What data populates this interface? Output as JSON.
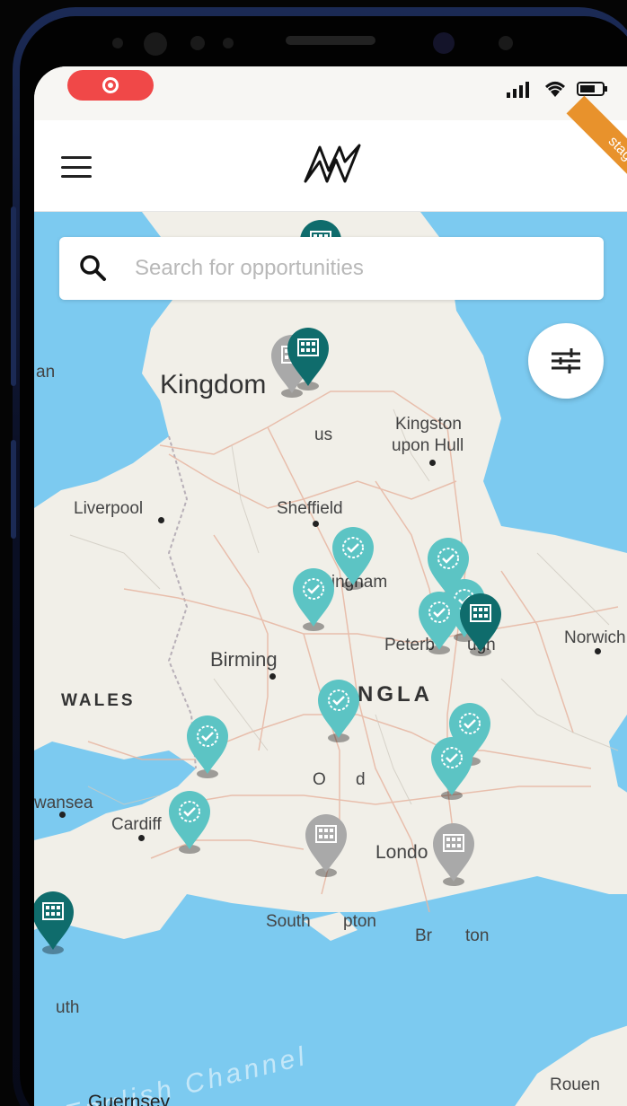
{
  "status_bar": {
    "record_indicator": "record-icon",
    "icons": [
      "signal-icon",
      "wifi-icon",
      "battery-icon"
    ]
  },
  "header": {
    "menu_icon": "hamburger-menu-icon",
    "logo": "brand-logo",
    "env_badge": "stag"
  },
  "search": {
    "placeholder": "Search for opportunities"
  },
  "filter": {
    "icon": "sliders-icon"
  },
  "map_labels": {
    "kingdom": "Kingdom",
    "an": "an",
    "us": "us",
    "kingston": "Kingston",
    "upon_hull": "upon Hull",
    "liverpool": "Liverpool",
    "sheffield": "Sheffield",
    "nottingham": "Nottingham",
    "peterborough_a": "Peterb",
    "peterborough_b": "ugh",
    "norwich": "Norwich",
    "birmingham": "Birming",
    "wales": "WALES",
    "england": "ENGLA",
    "oxford_a": "O",
    "oxford_b": "d",
    "swansea": "wansea",
    "cardiff": "Cardiff",
    "london": "Londo",
    "southampton_a": "South",
    "southampton_b": "pton",
    "brighton_a": "Br",
    "brighton_b": "ton",
    "plymouth": "uth",
    "english_channel": "English Channel",
    "guernsey": "Guernsey",
    "rouen": "Rouen"
  },
  "colors": {
    "sea": "#7ccaf0",
    "land": "#f1efe8",
    "pin_teal": "#5cc4c4",
    "pin_dark": "#0f6c6c",
    "pin_grey": "#a9a9a9",
    "ribbon": "#e8922c",
    "record": "#f04848"
  },
  "pins": [
    {
      "type": "dark",
      "icon": "building-icon"
    },
    {
      "type": "grey",
      "icon": "building-icon"
    },
    {
      "type": "dark",
      "icon": "building-icon"
    },
    {
      "type": "teal",
      "icon": "verified-badge-icon"
    },
    {
      "type": "teal",
      "icon": "verified-badge-icon"
    },
    {
      "type": "teal",
      "icon": "verified-badge-icon"
    },
    {
      "type": "teal",
      "icon": "verified-badge-icon"
    },
    {
      "type": "teal",
      "icon": "verified-badge-icon"
    },
    {
      "type": "dark",
      "icon": "building-icon"
    },
    {
      "type": "teal",
      "icon": "verified-badge-icon"
    },
    {
      "type": "teal",
      "icon": "verified-badge-icon"
    },
    {
      "type": "teal",
      "icon": "verified-badge-icon"
    },
    {
      "type": "teal",
      "icon": "verified-badge-icon"
    },
    {
      "type": "teal",
      "icon": "verified-badge-icon"
    },
    {
      "type": "grey",
      "icon": "building-icon"
    },
    {
      "type": "grey",
      "icon": "building-icon"
    },
    {
      "type": "dark",
      "icon": "building-icon"
    }
  ]
}
